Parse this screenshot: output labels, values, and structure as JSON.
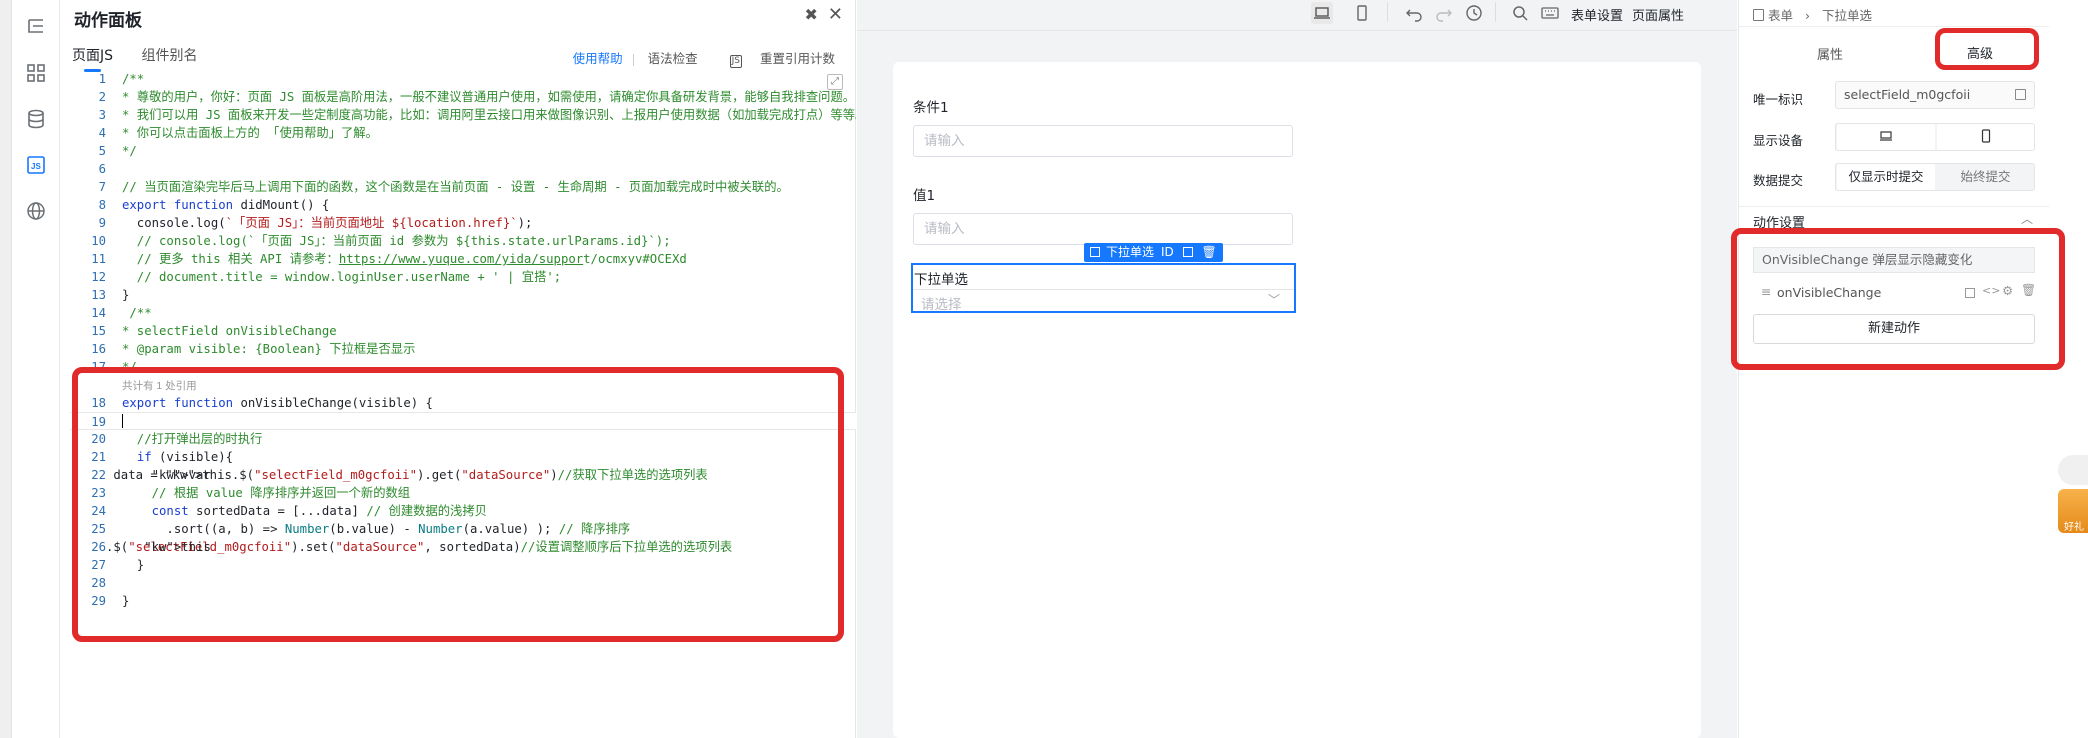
{
  "panel": {
    "title": "动作面板",
    "tabs": [
      "页面JS",
      "组件别名"
    ],
    "links": {
      "help": "使用帮助",
      "check": "语法检查",
      "reset": "重置引用计数",
      "js_badge": "JS"
    },
    "ref_hint": "共计有 1 处引用"
  },
  "code_lines": [
    {
      "n": "1",
      "t": "/**",
      "c": "cm"
    },
    {
      "n": "2",
      "t": "* 尊敬的用户，你好：页面 JS 面板是高阶用法，一般不建议普通用户使用，如需使用，请确定你具备研发背景，能够自我排查问题。当然",
      "c": "cm"
    },
    {
      "n": "3",
      "t": "* 我们可以用 JS 面板来开发一些定制度高功能，比如：调用阿里云接口用来做图像识别、上报用户使用数据（如加载完成打点）等等。",
      "c": "cm"
    },
    {
      "n": "4",
      "t": "* 你可以点击面板上方的 「使用帮助」了解。",
      "c": "cm"
    },
    {
      "n": "5",
      "t": "*/",
      "c": "cm"
    },
    {
      "n": "6",
      "t": "",
      "c": ""
    },
    {
      "n": "7",
      "t": "// 当页面渲染完毕后马上调用下面的函数，这个函数是在当前页面 - 设置 - 生命周期 - 页面加载完成时中被关联的。",
      "c": "cm"
    },
    {
      "n": "8",
      "t": "export function didMount() {",
      "c": "kw"
    },
    {
      "n": "9",
      "t": "  console.log(`「页面 JS」：当前页面地址 ${location.href}`);",
      "c": "mix1"
    },
    {
      "n": "10",
      "t": "  // console.log(`「页面 JS」：当前页面 id 参数为 ${this.state.urlParams.id}`);",
      "c": "cm"
    },
    {
      "n": "11",
      "t": "  // 更多 this 相关 API 请参考：https://www.yuque.com/yida/support/ocmxyv#OCEXd",
      "c": "cm"
    },
    {
      "n": "12",
      "t": "  // document.title = window.loginUser.userName + ' | 宜搭';",
      "c": "cm"
    },
    {
      "n": "13",
      "t": "}",
      "c": "fn"
    },
    {
      "n": "14",
      "t": " /**",
      "c": "cm"
    },
    {
      "n": "15",
      "t": "* selectField onVisibleChange",
      "c": "cm"
    },
    {
      "n": "16",
      "t": "* @param visible: {Boolean} 下拉框是否显示",
      "c": "cm"
    },
    {
      "n": "17",
      "t": "*/",
      "c": "cm"
    },
    {
      "n": "18",
      "t": "export function onVisibleChange(visible) {",
      "c": "kw"
    },
    {
      "n": "19",
      "t": "",
      "c": ""
    },
    {
      "n": "20",
      "t": "  //打开弹出层的时执行",
      "c": "cm"
    },
    {
      "n": "21",
      "t": "  if (visible){",
      "c": "kw"
    },
    {
      "n": "22",
      "t": "    var data = this.$(\"selectField_m0gcfoii\").get(\"dataSource\")//获取下拉单选的选项列表",
      "c": "mix2"
    },
    {
      "n": "23",
      "t": "    // 根据 value 降序排序并返回一个新的数组",
      "c": "cm"
    },
    {
      "n": "24",
      "t": "    const sortedData = [...data] // 创建数据的浅拷贝",
      "c": "mix3"
    },
    {
      "n": "25",
      "t": "      .sort((a, b) => Number(b.value) - Number(a.value) ); // 降序排序",
      "c": "mix4"
    },
    {
      "n": "26",
      "t": "   this.$(\"selectField_m0gcfoii\").set(\"dataSource\", sortedData)//设置调整顺序后下拉单选的选项列表",
      "c": "mix5"
    },
    {
      "n": "27",
      "t": "  }",
      "c": "fn"
    },
    {
      "n": "28",
      "t": "",
      "c": ""
    },
    {
      "n": "29",
      "t": "}",
      "c": "fn"
    }
  ],
  "toolbar": {
    "form_settings": "表单设置",
    "page_props": "页面属性"
  },
  "form": {
    "field1_label": "条件1",
    "field1_placeholder": "请输入",
    "field2_label": "值1",
    "field2_placeholder": "请输入",
    "select_label": "下拉单选",
    "select_placeholder": "请选择",
    "select_tag": "下拉单选",
    "id_tag": "ID"
  },
  "right": {
    "breadcrumb": [
      "表单",
      "下拉单选"
    ],
    "tabs": [
      "属性",
      "高级"
    ],
    "unique_id_label": "唯一标识",
    "unique_id_value": "selectField_m0gcfoii",
    "display_device_label": "显示设备",
    "data_submit_label": "数据提交",
    "submit_options": [
      "仅显示时提交",
      "始终提交"
    ],
    "action_settings": "动作设置",
    "event_name": "OnVisibleChange 弹层显示隐藏变化",
    "handler": "onVisibleChange",
    "new_action": "新建动作"
  },
  "gift": {
    "text": "好礼"
  },
  "colors": {
    "accent": "#1677ff",
    "highlight_red": "#e12b2b"
  }
}
